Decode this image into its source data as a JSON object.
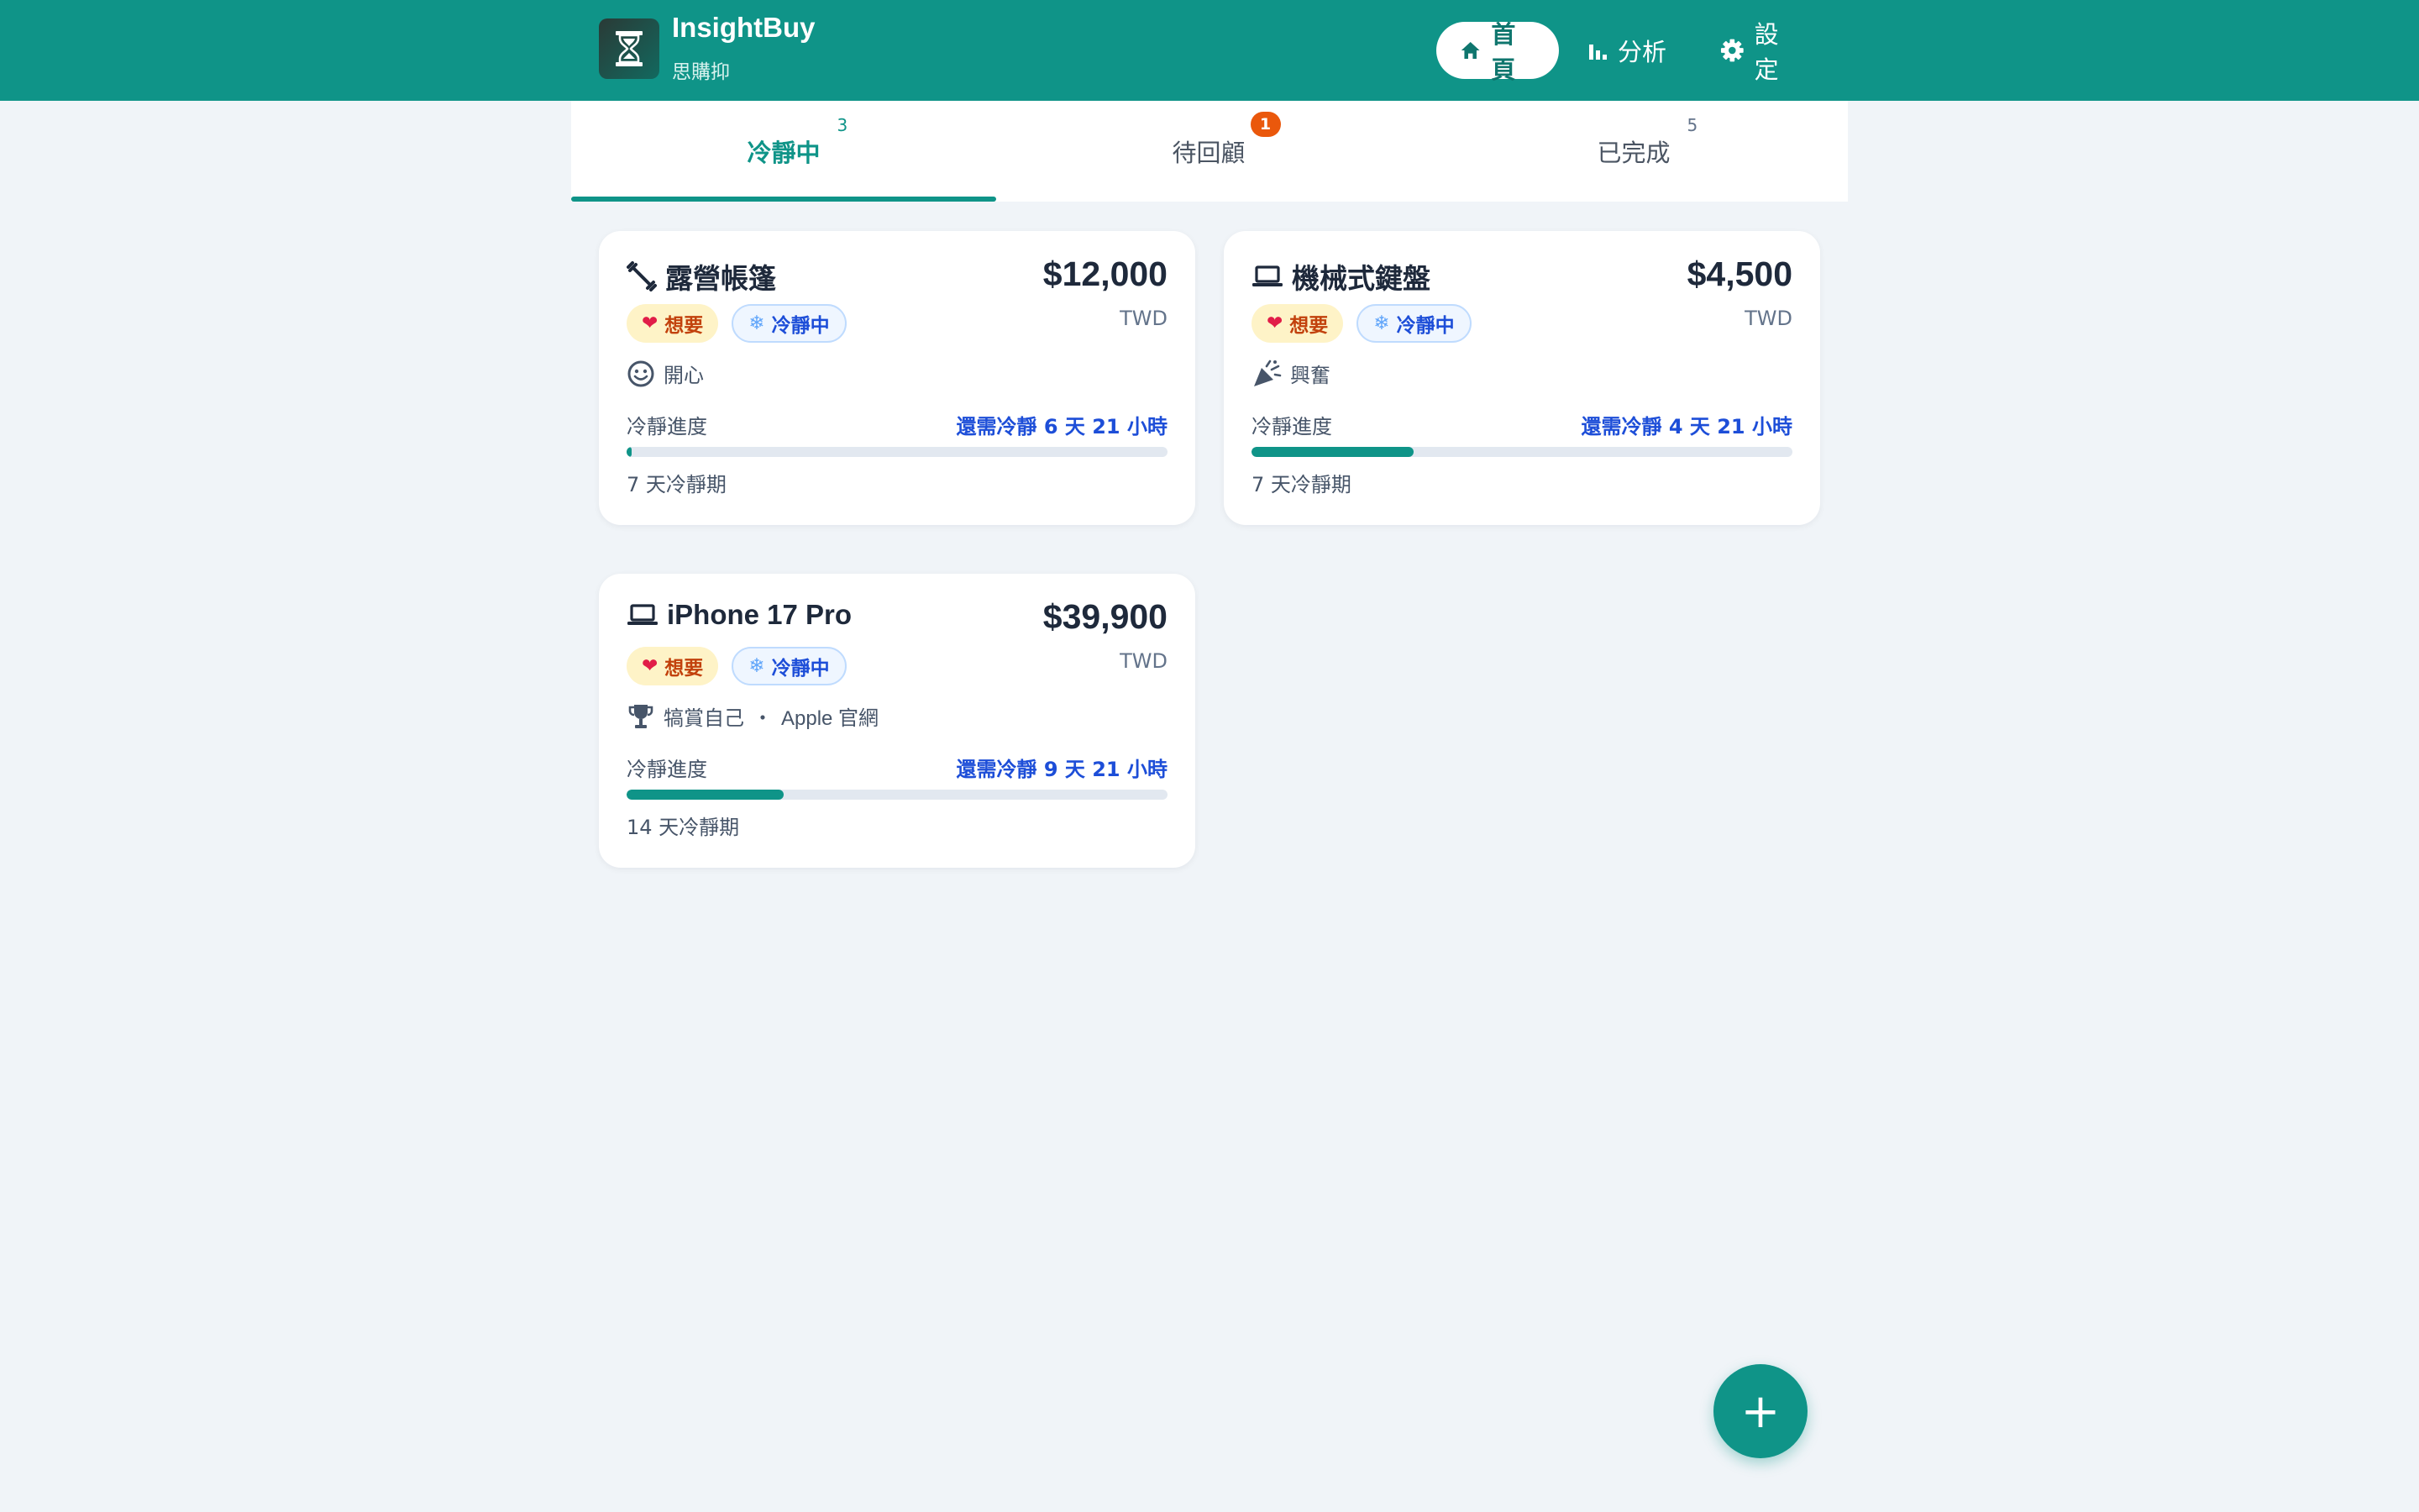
{
  "app": {
    "name": "InsightBuy",
    "subtitle": "思購抑",
    "logo_icon": "hourglass-icon"
  },
  "nav": {
    "home": "首頁",
    "analytics": "分析",
    "settings": "設定"
  },
  "tabs": [
    {
      "label": "冷靜中",
      "count": "3"
    },
    {
      "label": "待回顧",
      "count": "1"
    },
    {
      "label": "已完成",
      "count": "5"
    }
  ],
  "cards": [
    {
      "icon": "dumbbell-icon",
      "title": "露營帳篷",
      "price": "$12,000",
      "currency": "TWD",
      "chip_want": "想要",
      "chip_cooling": "冷靜中",
      "meta_icon": "smiley-icon",
      "meta": "開心",
      "progress_label": "冷靜進度",
      "remaining": "還需冷靜 6 天 21 小時",
      "progress": 0.01,
      "period": "7 天冷靜期"
    },
    {
      "icon": "laptop-icon",
      "title": "機械式鍵盤",
      "price": "$4,500",
      "currency": "TWD",
      "chip_want": "想要",
      "chip_cooling": "冷靜中",
      "meta_icon": "party-popper-icon",
      "meta": "興奮",
      "progress_label": "冷靜進度",
      "remaining": "還需冷靜 4 天 21 小時",
      "progress": 0.3,
      "period": "7 天冷靜期"
    },
    {
      "icon": "laptop-icon",
      "title": "iPhone 17 Pro",
      "price": "$39,900",
      "currency": "TWD",
      "chip_want": "想要",
      "chip_cooling": "冷靜中",
      "meta_icon": "trophy-icon",
      "meta": "犒賞自己",
      "meta_sep": "・",
      "meta_source": "Apple 官網",
      "progress_label": "冷靜進度",
      "remaining": "還需冷靜 9 天 21 小時",
      "progress": 0.29,
      "period": "14 天冷靜期"
    }
  ],
  "fab": {
    "label": "+"
  },
  "colors": {
    "primary": "#0f9488",
    "background": "#f0f4f8",
    "accent_blue": "#1d4ed8",
    "badge_orange": "#ea580c"
  }
}
